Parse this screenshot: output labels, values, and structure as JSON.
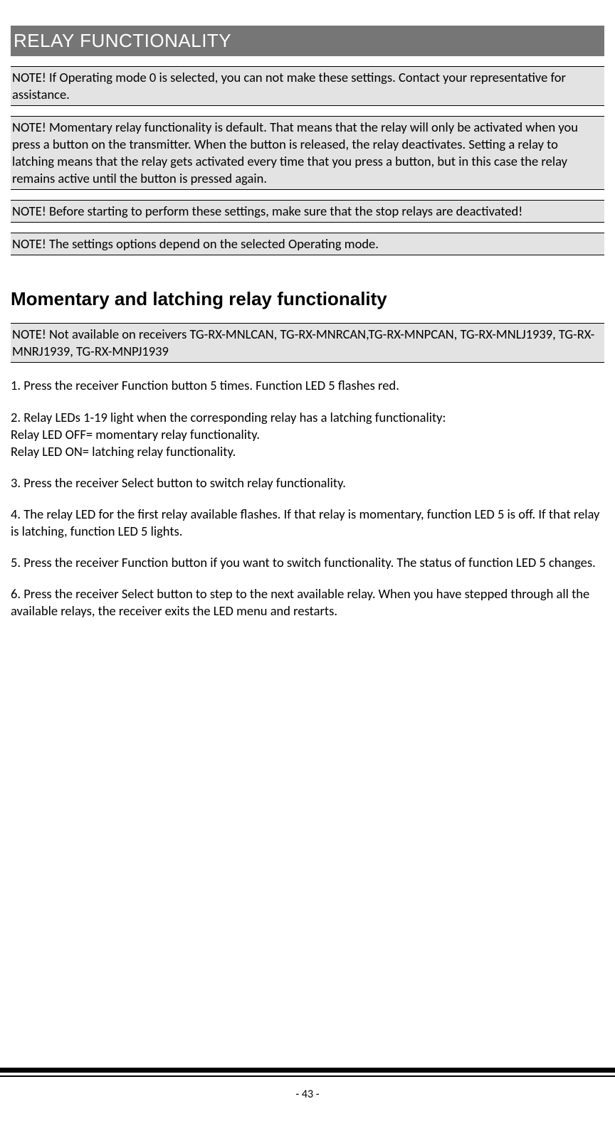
{
  "title": "RELAY FUNCTIONALITY",
  "notes": {
    "n1": "NOTE! If Operating mode 0 is selected, you can not make these settings. Contact your representative for assistance.",
    "n2": "NOTE! Momentary relay functionality is default. That means that the relay will only be activated when you press a button on the transmitter. When the button is released, the relay deactivates. Setting a relay to latching means that the relay gets activated every time that you press a button, but in this case the relay remains active until the button is pressed again.",
    "n3": "NOTE! Before starting to perform these settings, make sure that the stop relays are deactivated!",
    "n4": "NOTE! The settings options depend on the selected Operating mode.",
    "n5": "NOTE! Not available on receivers TG-RX-MNLCAN, TG-RX-MNRCAN,TG-RX-MNPCAN, TG-RX-MNLJ1939, TG-RX-MNRJ1939, TG-RX-MNPJ1939"
  },
  "section_heading": "Momentary and latching relay functionality",
  "steps": {
    "s1": "1. Press the receiver Function button 5 times. Function LED 5 flashes red.",
    "s2": "2. Relay LEDs 1-19 light when the corresponding relay has a latching functionality:",
    "s2a": "Relay LED OFF= momentary relay functionality.",
    "s2b": "Relay LED ON= latching relay functionality.",
    "s3": "3. Press the receiver Select button to switch relay functionality.",
    "s4": "4. The relay LED for the first relay available flashes. If that relay is momentary, function LED 5 is off. If that relay is latching, function LED 5 lights.",
    "s5": "5. Press the receiver Function button if you want to switch functionality. The status of function LED 5 changes.",
    "s6": "6. Press the receiver Select button to step to the next available relay. When you have stepped through all the available relays, the receiver exits the LED menu and restarts."
  },
  "page_number": "- 43 -"
}
